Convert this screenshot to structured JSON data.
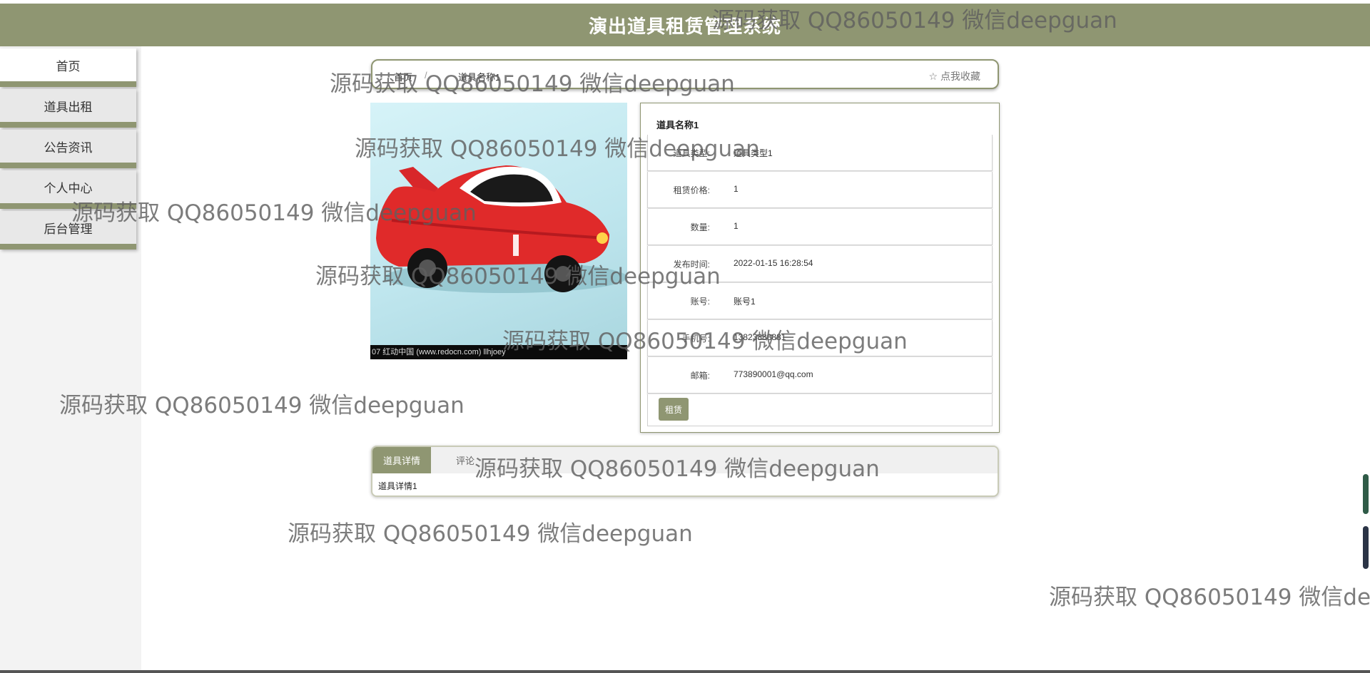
{
  "header": {
    "title": "演出道具租赁管理系统"
  },
  "sidebar": {
    "items": [
      {
        "label": "首页"
      },
      {
        "label": "道具出租"
      },
      {
        "label": "公告资讯"
      },
      {
        "label": "个人中心"
      },
      {
        "label": "后台管理"
      }
    ]
  },
  "breadcrumb": {
    "home": "首页",
    "separator": "/",
    "current": "道具名称1",
    "favorite": "☆ 点我收藏"
  },
  "product": {
    "image_caption": "07   红动中国 (www.redocn.com)   llhjoey",
    "name": "道具名称1",
    "fields": [
      {
        "label": "道具类型:",
        "value": "道具类型1"
      },
      {
        "label": "租赁价格:",
        "value": "1"
      },
      {
        "label": "数量:",
        "value": "1"
      },
      {
        "label": "发布时间:",
        "value": "2022-01-15 16:28:54"
      },
      {
        "label": "账号:",
        "value": "账号1"
      },
      {
        "label": "手机号:",
        "value": "13823888881"
      },
      {
        "label": "邮箱:",
        "value": "773890001@qq.com"
      }
    ],
    "rent_button": "租赁"
  },
  "tabs": {
    "items": [
      {
        "label": "道具详情"
      },
      {
        "label": "评论"
      }
    ],
    "content": "道具详情1"
  },
  "watermark": {
    "text": "源码获取 QQ86050149 微信deepguan"
  },
  "colors": {
    "accent": "#8f9672",
    "sidebar_bg": "#f3f3f3"
  }
}
